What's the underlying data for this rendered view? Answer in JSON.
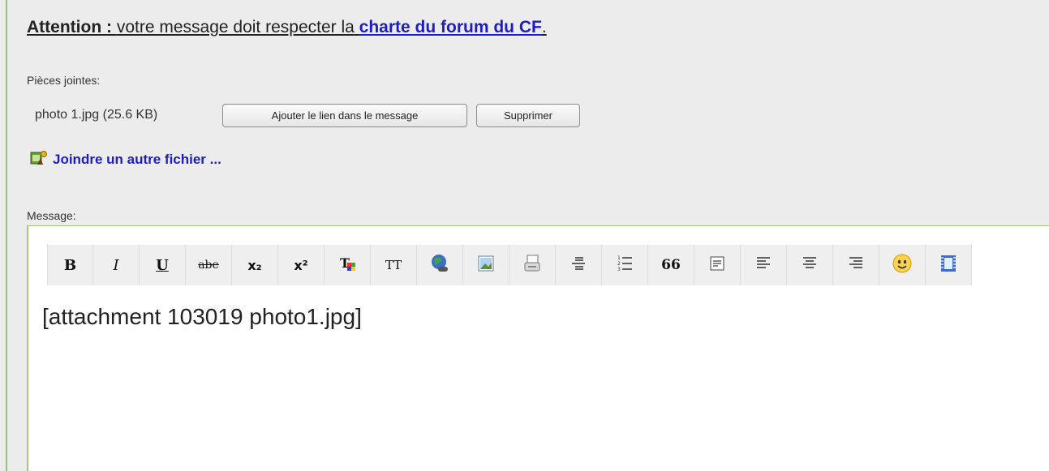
{
  "notice": {
    "attention_label": "Attention :",
    "text": "votre message doit respecter la",
    "link_text": "charte du forum du CF",
    "period": "."
  },
  "attachments": {
    "label": "Pièces jointes:",
    "file": "photo 1.jpg (25.6 KB)",
    "add_link_button": "Ajouter le lien dans le message",
    "delete_button": "Supprimer",
    "join_another": "Joindre un autre fichier ..."
  },
  "message": {
    "label": "Message:",
    "content": "[attachment 103019 photo1.jpg]"
  },
  "toolbar": {
    "bold": "B",
    "italic": "I",
    "underline": "U",
    "strike": "abe",
    "subscript": "x₂",
    "superscript": "x²",
    "text_color": "T",
    "font_size": "TT",
    "quote": "66"
  },
  "colors": {
    "accent_link": "#1d1dc8",
    "frame_border": "#a7c67f",
    "panel_bg": "#ececec"
  }
}
